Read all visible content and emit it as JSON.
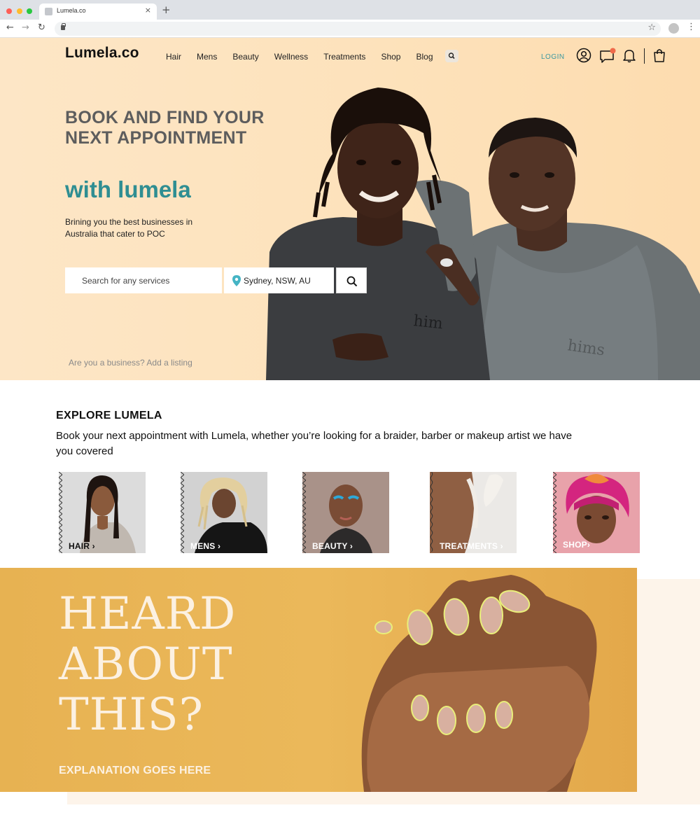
{
  "browser": {
    "tab_title": "Lumela.co",
    "tab_close": "×",
    "new_tab": "+",
    "back": "←",
    "forward": "→",
    "reload": "↻",
    "star": "☆",
    "menu": "⋮"
  },
  "header": {
    "logo": "Lumela.co",
    "nav": [
      "Hair",
      "Mens",
      "Beauty",
      "Wellness",
      "Treatments",
      "Shop",
      "Blog"
    ],
    "login": "LOGIN",
    "icons": [
      "search-icon",
      "user-icon",
      "chat-icon",
      "bell-icon",
      "shopping-bag-icon"
    ],
    "accent_color": "#3b98a0",
    "badge_color": "#f06a4a"
  },
  "hero": {
    "title": "BOOK AND FIND YOUR NEXT APPOINTMENT",
    "subtitle": "with lumela",
    "tagline": "Brining you the best businesses in Australia that cater to  POC",
    "search_placeholder": "Search for any services",
    "location": "Sydney,  NSW, AU",
    "business_link": "Are you a business? Add a listing",
    "background_color": "#fde2bb",
    "title_color": "#5d5d5d",
    "subtitle_color": "#2f8e92"
  },
  "explore": {
    "title": "EXPLORE LUMELA",
    "description": "Book your next appointment with  Lumela, whether you’re looking for a braider, barber or makeup artist we have you covered",
    "categories": [
      {
        "label": "HAIR ",
        "chevron": "›"
      },
      {
        "label": "MENS ",
        "chevron": "›"
      },
      {
        "label": "BEAUTY ",
        "chevron": "›"
      },
      {
        "label": "TREATMENTS ",
        "chevron": "›"
      },
      {
        "label": "SHOP",
        "chevron": "›"
      }
    ]
  },
  "banner": {
    "line1": "HEARD",
    "line2": "ABOUT",
    "line3": "THIS?",
    "explanation": "EXPLANATION GOES HERE",
    "background_color": "#e7b252"
  }
}
